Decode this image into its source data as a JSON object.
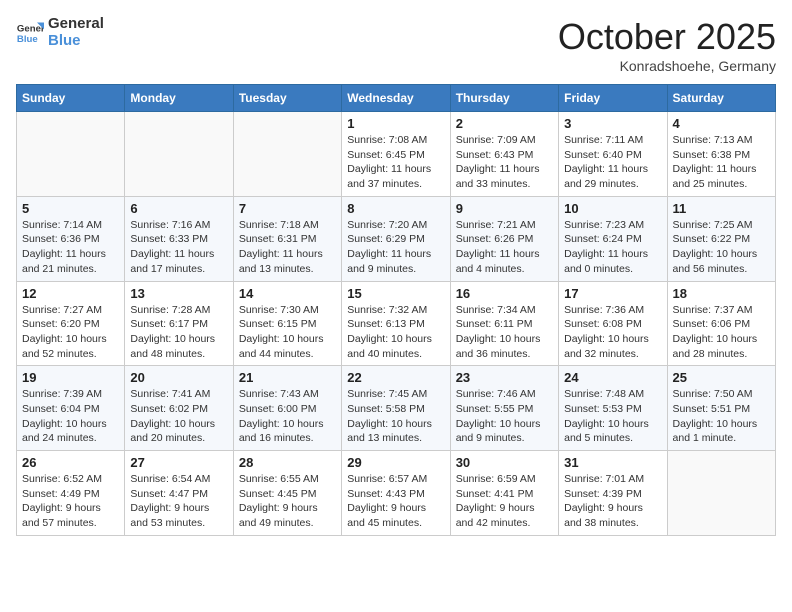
{
  "header": {
    "logo_line1": "General",
    "logo_line2": "Blue",
    "month": "October 2025",
    "location": "Konradshoehe, Germany"
  },
  "weekdays": [
    "Sunday",
    "Monday",
    "Tuesday",
    "Wednesday",
    "Thursday",
    "Friday",
    "Saturday"
  ],
  "weeks": [
    [
      {
        "day": "",
        "info": ""
      },
      {
        "day": "",
        "info": ""
      },
      {
        "day": "",
        "info": ""
      },
      {
        "day": "1",
        "info": "Sunrise: 7:08 AM\nSunset: 6:45 PM\nDaylight: 11 hours\nand 37 minutes."
      },
      {
        "day": "2",
        "info": "Sunrise: 7:09 AM\nSunset: 6:43 PM\nDaylight: 11 hours\nand 33 minutes."
      },
      {
        "day": "3",
        "info": "Sunrise: 7:11 AM\nSunset: 6:40 PM\nDaylight: 11 hours\nand 29 minutes."
      },
      {
        "day": "4",
        "info": "Sunrise: 7:13 AM\nSunset: 6:38 PM\nDaylight: 11 hours\nand 25 minutes."
      }
    ],
    [
      {
        "day": "5",
        "info": "Sunrise: 7:14 AM\nSunset: 6:36 PM\nDaylight: 11 hours\nand 21 minutes."
      },
      {
        "day": "6",
        "info": "Sunrise: 7:16 AM\nSunset: 6:33 PM\nDaylight: 11 hours\nand 17 minutes."
      },
      {
        "day": "7",
        "info": "Sunrise: 7:18 AM\nSunset: 6:31 PM\nDaylight: 11 hours\nand 13 minutes."
      },
      {
        "day": "8",
        "info": "Sunrise: 7:20 AM\nSunset: 6:29 PM\nDaylight: 11 hours\nand 9 minutes."
      },
      {
        "day": "9",
        "info": "Sunrise: 7:21 AM\nSunset: 6:26 PM\nDaylight: 11 hours\nand 4 minutes."
      },
      {
        "day": "10",
        "info": "Sunrise: 7:23 AM\nSunset: 6:24 PM\nDaylight: 11 hours\nand 0 minutes."
      },
      {
        "day": "11",
        "info": "Sunrise: 7:25 AM\nSunset: 6:22 PM\nDaylight: 10 hours\nand 56 minutes."
      }
    ],
    [
      {
        "day": "12",
        "info": "Sunrise: 7:27 AM\nSunset: 6:20 PM\nDaylight: 10 hours\nand 52 minutes."
      },
      {
        "day": "13",
        "info": "Sunrise: 7:28 AM\nSunset: 6:17 PM\nDaylight: 10 hours\nand 48 minutes."
      },
      {
        "day": "14",
        "info": "Sunrise: 7:30 AM\nSunset: 6:15 PM\nDaylight: 10 hours\nand 44 minutes."
      },
      {
        "day": "15",
        "info": "Sunrise: 7:32 AM\nSunset: 6:13 PM\nDaylight: 10 hours\nand 40 minutes."
      },
      {
        "day": "16",
        "info": "Sunrise: 7:34 AM\nSunset: 6:11 PM\nDaylight: 10 hours\nand 36 minutes."
      },
      {
        "day": "17",
        "info": "Sunrise: 7:36 AM\nSunset: 6:08 PM\nDaylight: 10 hours\nand 32 minutes."
      },
      {
        "day": "18",
        "info": "Sunrise: 7:37 AM\nSunset: 6:06 PM\nDaylight: 10 hours\nand 28 minutes."
      }
    ],
    [
      {
        "day": "19",
        "info": "Sunrise: 7:39 AM\nSunset: 6:04 PM\nDaylight: 10 hours\nand 24 minutes."
      },
      {
        "day": "20",
        "info": "Sunrise: 7:41 AM\nSunset: 6:02 PM\nDaylight: 10 hours\nand 20 minutes."
      },
      {
        "day": "21",
        "info": "Sunrise: 7:43 AM\nSunset: 6:00 PM\nDaylight: 10 hours\nand 16 minutes."
      },
      {
        "day": "22",
        "info": "Sunrise: 7:45 AM\nSunset: 5:58 PM\nDaylight: 10 hours\nand 13 minutes."
      },
      {
        "day": "23",
        "info": "Sunrise: 7:46 AM\nSunset: 5:55 PM\nDaylight: 10 hours\nand 9 minutes."
      },
      {
        "day": "24",
        "info": "Sunrise: 7:48 AM\nSunset: 5:53 PM\nDaylight: 10 hours\nand 5 minutes."
      },
      {
        "day": "25",
        "info": "Sunrise: 7:50 AM\nSunset: 5:51 PM\nDaylight: 10 hours\nand 1 minute."
      }
    ],
    [
      {
        "day": "26",
        "info": "Sunrise: 6:52 AM\nSunset: 4:49 PM\nDaylight: 9 hours\nand 57 minutes."
      },
      {
        "day": "27",
        "info": "Sunrise: 6:54 AM\nSunset: 4:47 PM\nDaylight: 9 hours\nand 53 minutes."
      },
      {
        "day": "28",
        "info": "Sunrise: 6:55 AM\nSunset: 4:45 PM\nDaylight: 9 hours\nand 49 minutes."
      },
      {
        "day": "29",
        "info": "Sunrise: 6:57 AM\nSunset: 4:43 PM\nDaylight: 9 hours\nand 45 minutes."
      },
      {
        "day": "30",
        "info": "Sunrise: 6:59 AM\nSunset: 4:41 PM\nDaylight: 9 hours\nand 42 minutes."
      },
      {
        "day": "31",
        "info": "Sunrise: 7:01 AM\nSunset: 4:39 PM\nDaylight: 9 hours\nand 38 minutes."
      },
      {
        "day": "",
        "info": ""
      }
    ]
  ]
}
